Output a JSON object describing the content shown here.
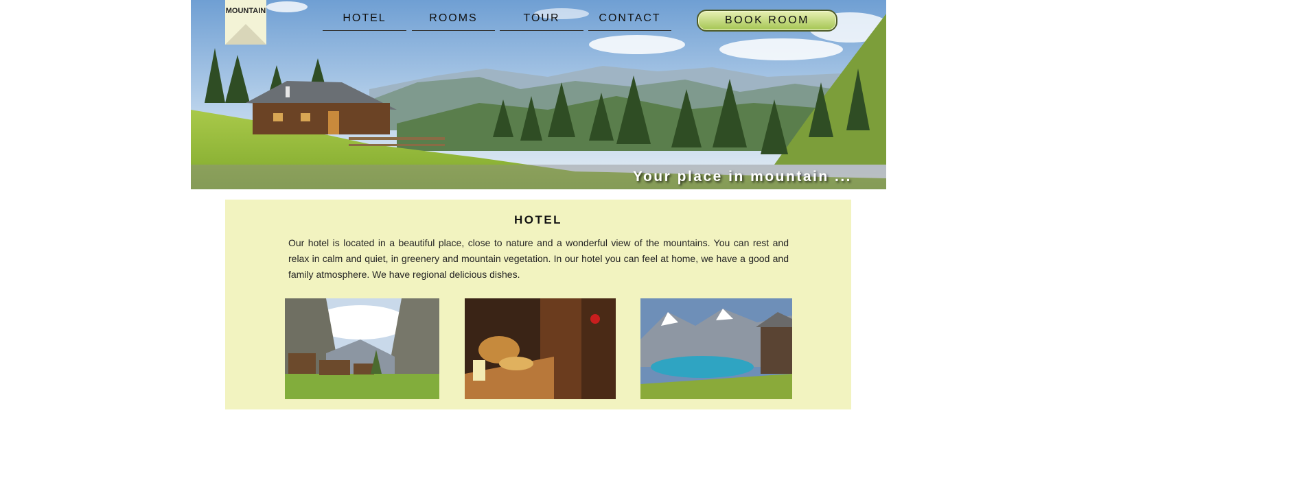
{
  "logo": {
    "text": "MOUNTAIN"
  },
  "nav": {
    "items": [
      {
        "label": "HOTEL"
      },
      {
        "label": "ROOMS"
      },
      {
        "label": "TOUR"
      },
      {
        "label": "CONTACT"
      }
    ],
    "book_label": "BOOK ROOM"
  },
  "hero": {
    "tagline": "Your place in mountain ..."
  },
  "section": {
    "title": "HOTEL",
    "text": "Our hotel is located in a beautiful place, close to nature and a wonderful view of the mountains. You can rest and relax in calm and quiet, in greenery and mountain vegetation. In our hotel you can feel at home, we have a good and family atmosphere. We have regional delicious dishes."
  },
  "colors": {
    "content_bg": "#f2f3c0",
    "logo_bg": "#f3f3d6",
    "button_top": "#e7f0b4",
    "button_bottom": "#a4c552"
  }
}
